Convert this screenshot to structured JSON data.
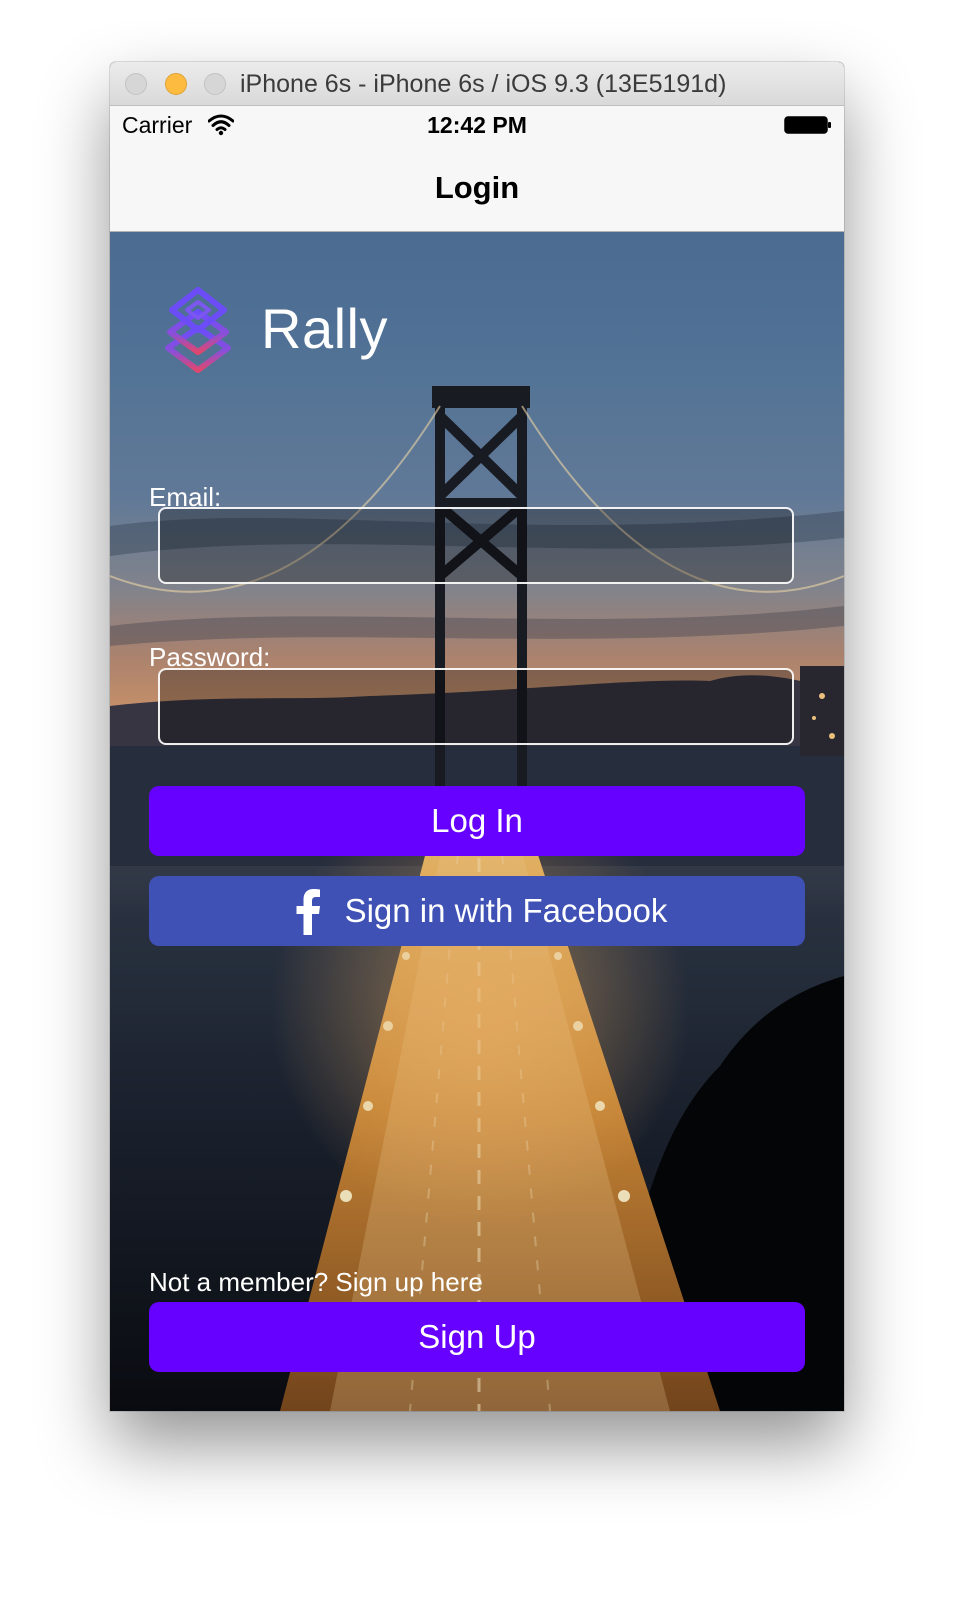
{
  "window": {
    "title": "iPhone 6s - iPhone 6s / iOS 9.3 (13E5191d)"
  },
  "status_bar": {
    "carrier": "Carrier",
    "time": "12:42 PM",
    "icons": [
      "wifi-icon",
      "battery-icon"
    ]
  },
  "nav": {
    "title": "Login"
  },
  "brand": {
    "name": "Rally",
    "logo": "stacked-diamonds-logo"
  },
  "form": {
    "email_label": "Email:",
    "email_value": "",
    "password_label": "Password:",
    "password_value": ""
  },
  "buttons": {
    "login": "Log In",
    "facebook": "Sign in with Facebook",
    "signup": "Sign Up"
  },
  "footer": {
    "signup_prompt": "Not a member? Sign up here"
  },
  "colors": {
    "primary_button": "#6600ff",
    "facebook_button": "#3f51b5"
  }
}
